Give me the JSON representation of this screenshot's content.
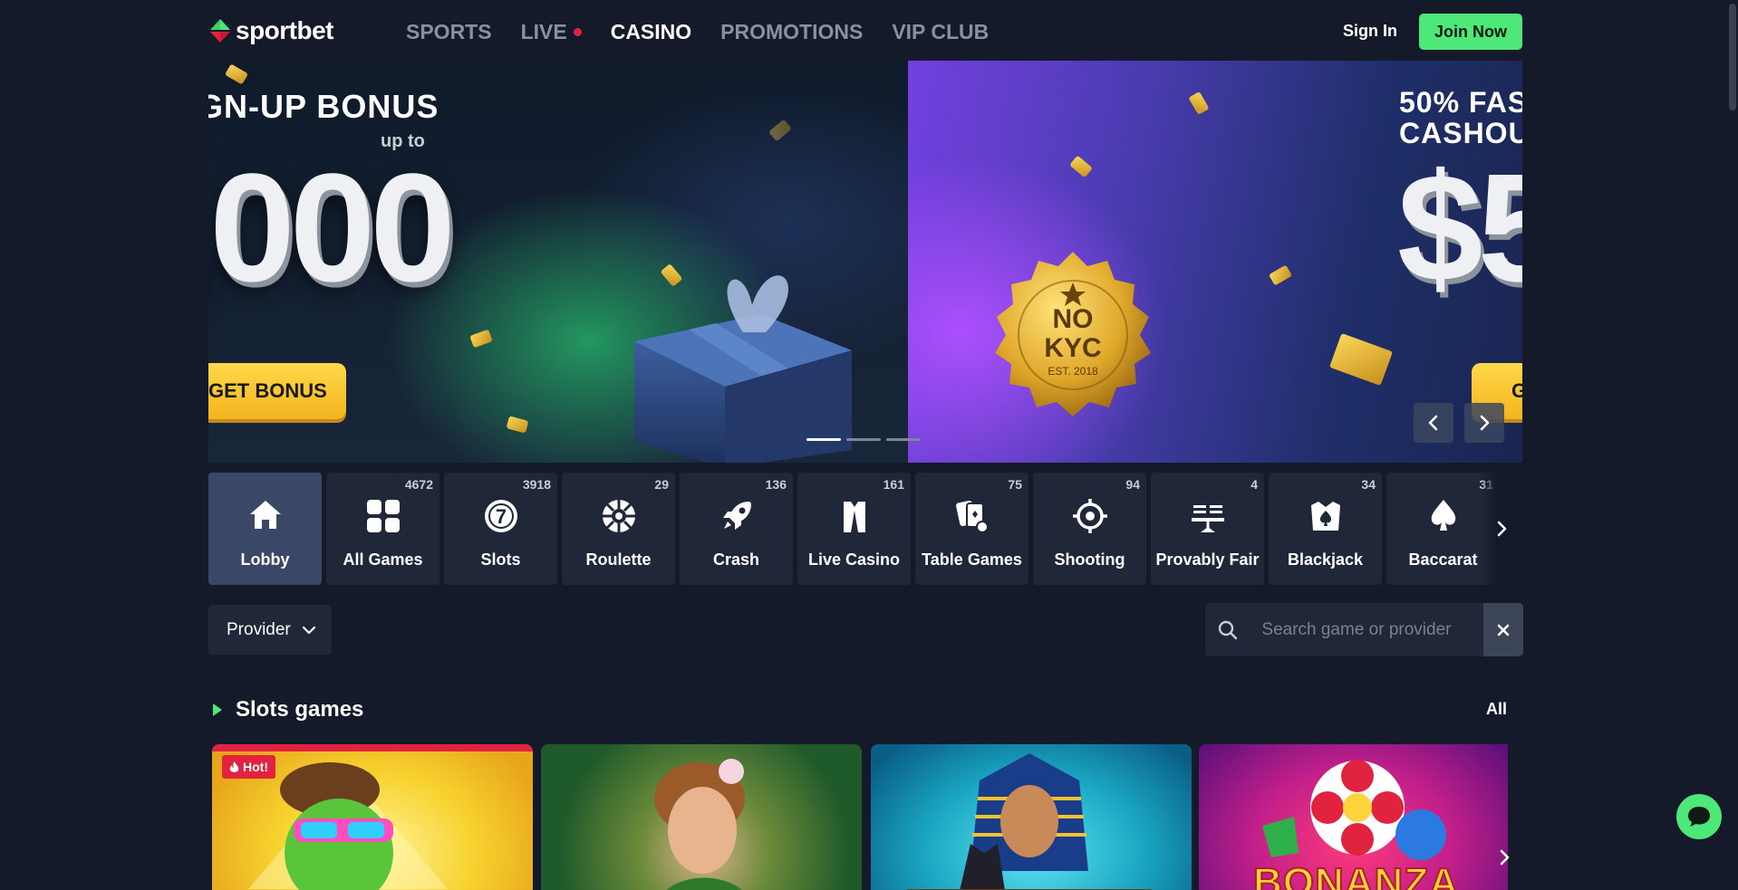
{
  "brand": {
    "name": "sportbet",
    "accent": "#4ee879",
    "live_dot": "#e2233f"
  },
  "nav": [
    {
      "label": "SPORTS",
      "active": false
    },
    {
      "label": "LIVE",
      "active": false,
      "live": true
    },
    {
      "label": "CASINO",
      "active": true
    },
    {
      "label": "PROMOTIONS",
      "active": false
    },
    {
      "label": "VIP CLUB",
      "active": false
    }
  ],
  "auth": {
    "signin": "Sign In",
    "join": "Join Now"
  },
  "hero": {
    "slide1": {
      "title": "GN-UP BONUS",
      "subtitle": "up to",
      "amount": ",000",
      "button": "GET BONUS"
    },
    "slide2": {
      "title_line1": "50% FAS",
      "title_line2": "CASHOU",
      "amount": "$5",
      "button": "G",
      "seal_line1": "NO",
      "seal_line2": "KYC",
      "seal_line3": "EST. 2018"
    },
    "active_slide": 1,
    "slide_count": 3
  },
  "categories": [
    {
      "label": "Lobby",
      "count": "",
      "icon": "home-icon",
      "active": true
    },
    {
      "label": "All Games",
      "count": "4672",
      "icon": "grid-icon"
    },
    {
      "label": "Slots",
      "count": "3918",
      "icon": "slots-icon"
    },
    {
      "label": "Roulette",
      "count": "29",
      "icon": "roulette-icon"
    },
    {
      "label": "Crash",
      "count": "136",
      "icon": "rocket-icon"
    },
    {
      "label": "Live Casino",
      "count": "161",
      "icon": "dealer-icon"
    },
    {
      "label": "Table Games",
      "count": "75",
      "icon": "cards-icon"
    },
    {
      "label": "Shooting",
      "count": "94",
      "icon": "crosshair-icon"
    },
    {
      "label": "Provably Fair",
      "count": "4",
      "icon": "scale-icon"
    },
    {
      "label": "Blackjack",
      "count": "34",
      "icon": "blackjack-icon"
    },
    {
      "label": "Baccarat",
      "count": "31",
      "icon": "spade-icon"
    }
  ],
  "filters": {
    "provider": "Provider",
    "search_placeholder": "Search game or provider"
  },
  "section": {
    "title": "Slots games",
    "all": "All"
  },
  "games": [
    {
      "badge": "Hot!"
    },
    {},
    {},
    {
      "title_art": "BONANZA"
    }
  ]
}
